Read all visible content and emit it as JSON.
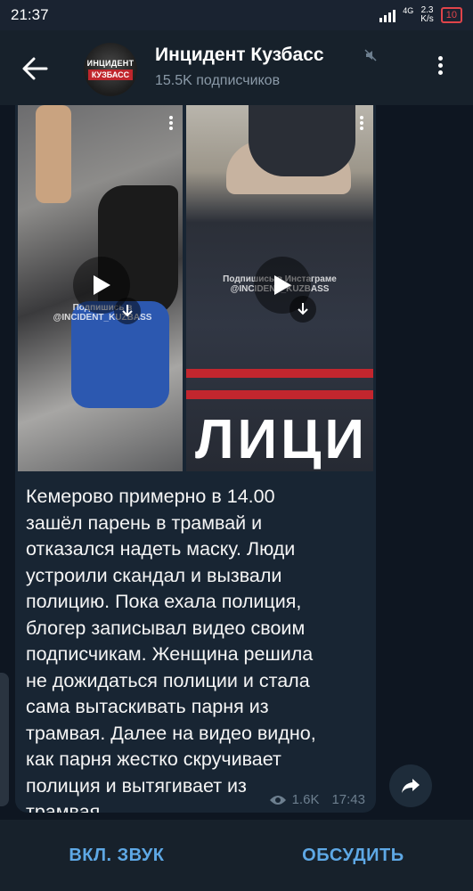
{
  "status": {
    "time": "21:37",
    "network": "4G",
    "speed_value": "2.3",
    "speed_unit": "K/s",
    "battery": "10"
  },
  "header": {
    "title": "Инцидент Кузбасс",
    "subscribers": "15.5K подписчиков",
    "avatar_line1": "ИНЦИДЕНТ",
    "avatar_line2": "КУЗБАСС",
    "muted": true
  },
  "post": {
    "video1_watermark_line1": "Подпишись в",
    "video1_watermark_line2": "@INCIDENT_KUZBASS",
    "video2_watermark_line1": "Подпишись в Инстаграме",
    "video2_watermark_line2": "@INCIDENT_KUZBASS",
    "video2_overlay_text": "ЛИЦИ",
    "text": "Кемерово примерно в 14.00\nзашёл парень в трамвай и\nотказался надеть маску. Люди\nустроили скандал и вызвали\nполицию. Пока ехала полиция,\nблогер записывал видео своим\nподписчикам. Женщина решила\nне дожидаться  полиции  и стала\nсама  вытаскивать парня из\nтрамвая. Далее на видео видно,\nкак парня жестко скручивает\nполиция и вытягивает из\nтрамвая.",
    "views": "1.6K",
    "time": "17:43"
  },
  "bottom": {
    "unmute_label": "ВКЛ. ЗВУК",
    "discuss_label": "ОБСУДИТЬ"
  },
  "colors": {
    "background": "#0e1621",
    "bar": "#17212b",
    "bubble": "#182533",
    "accent": "#5ea8e5"
  }
}
